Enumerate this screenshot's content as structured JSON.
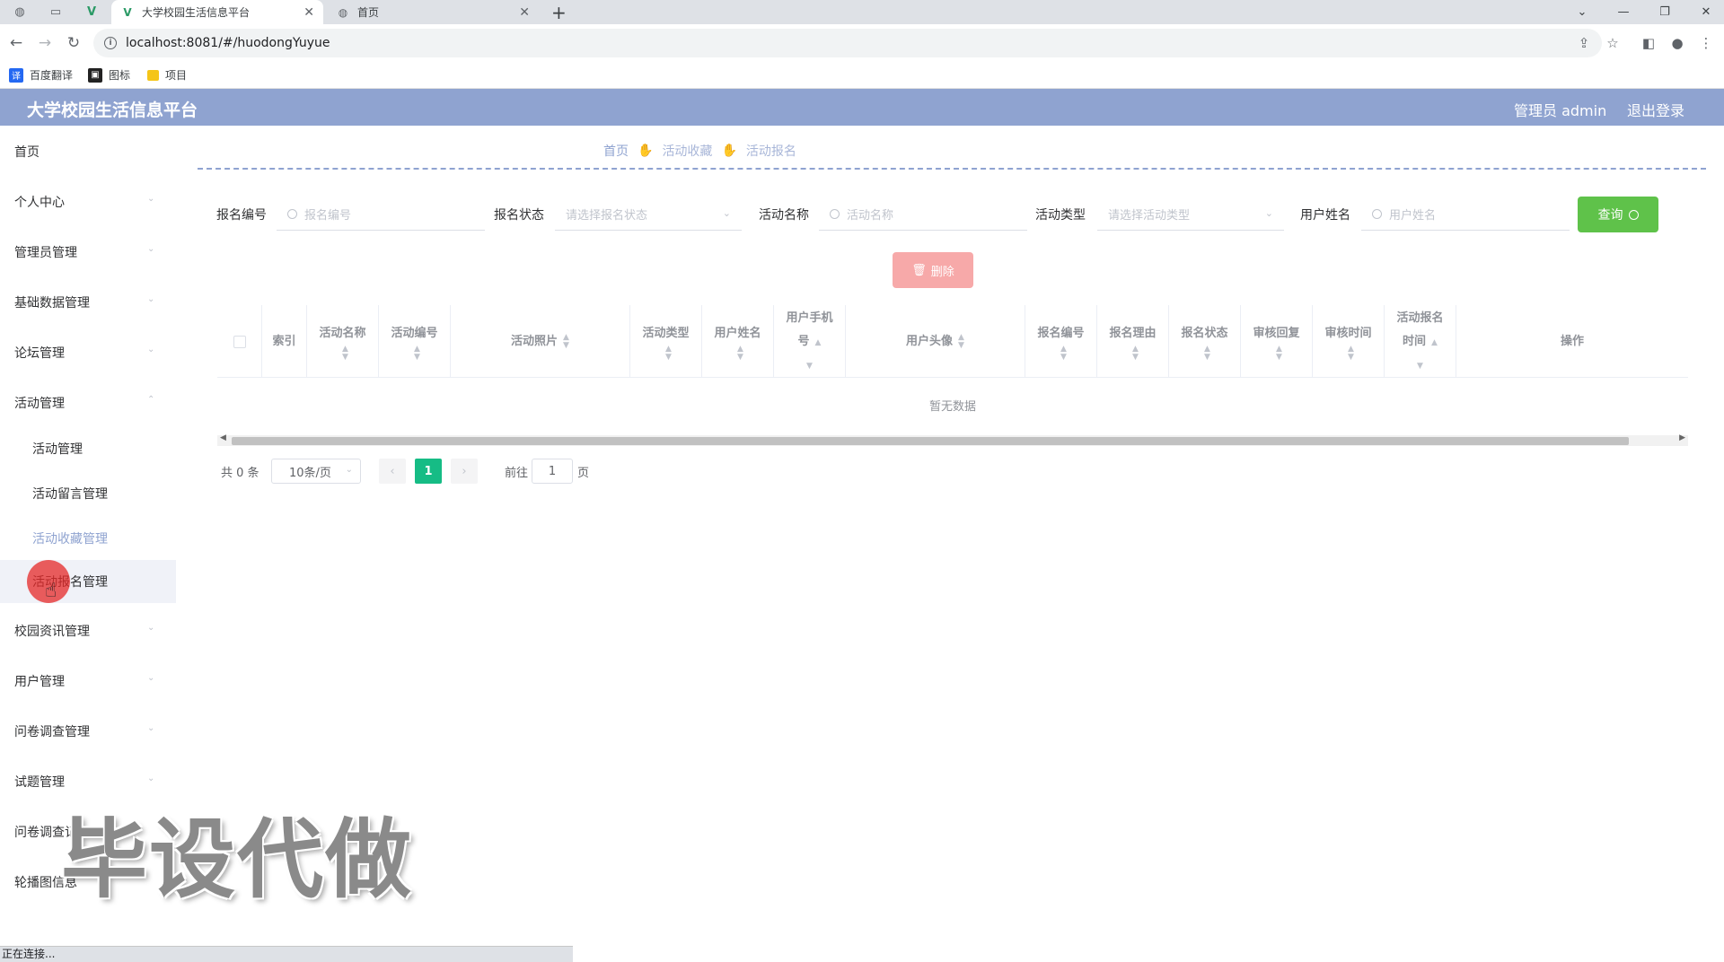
{
  "browser": {
    "tabs": [
      {
        "title": "大学校园生活信息平台",
        "active": true
      },
      {
        "title": "首页",
        "active": false
      }
    ],
    "new_tab": "+",
    "url": "localhost:8081/#/huodongYuyue",
    "bookmarks": [
      {
        "label": "百度翻译",
        "icon_text": "译",
        "color": "#2468f2"
      },
      {
        "label": "图标",
        "icon_text": "",
        "color": "#222222"
      },
      {
        "label": "项目",
        "icon_text": "",
        "color": "#f5c518"
      }
    ],
    "status_text": "正在连接..."
  },
  "header": {
    "title": "大学校园生活信息平台",
    "user": "管理员 admin",
    "logout": "退出登录",
    "color": "#8fa3d0"
  },
  "sidebar": {
    "items": [
      {
        "label": "首页"
      },
      {
        "label": "个人中心"
      },
      {
        "label": "管理员管理"
      },
      {
        "label": "基础数据管理"
      },
      {
        "label": "论坛管理"
      },
      {
        "label": "活动管理"
      },
      {
        "label": "活动管理"
      },
      {
        "label": "活动留言管理"
      },
      {
        "label": "活动收藏管理"
      },
      {
        "label": "活动报名管理"
      },
      {
        "label": "校园资讯管理"
      },
      {
        "label": "用户管理"
      },
      {
        "label": "问卷调查管理"
      },
      {
        "label": "试题管理"
      },
      {
        "label": "问卷调查记"
      },
      {
        "label": "轮播图信息"
      }
    ]
  },
  "breadcrumb": [
    "首页",
    "活动收藏",
    "活动报名"
  ],
  "search": {
    "fields": [
      {
        "label": "报名编号",
        "placeholder": "报名编号"
      },
      {
        "label": "报名状态",
        "placeholder": "请选择报名状态"
      },
      {
        "label": "活动名称",
        "placeholder": "活动名称"
      },
      {
        "label": "活动类型",
        "placeholder": "请选择活动类型"
      },
      {
        "label": "用户姓名",
        "placeholder": "用户姓名"
      }
    ],
    "query_button": "查询",
    "delete_button": "删除"
  },
  "table": {
    "columns": [
      "索引",
      "活动名称",
      "活动编号",
      "活动照片",
      "活动类型",
      "用户姓名",
      "用户手机",
      "号",
      "用户头像",
      "报名编号",
      "报名理由",
      "报名状态",
      "审核回复",
      "审核时间",
      "活动报名",
      "时间",
      "操作"
    ],
    "empty_text": "暂无数据"
  },
  "pagination": {
    "total": "共 0 条",
    "page_size": "10条/页",
    "current_page": "1",
    "goto_label": "前往",
    "goto_value": "1",
    "page_suffix": "页"
  },
  "watermark": "毕设代做",
  "colors": {
    "accent": "#8fa3d0",
    "success": "#5fc24a",
    "danger_light": "#f7a9a9",
    "pager_active": "#16bc85"
  }
}
